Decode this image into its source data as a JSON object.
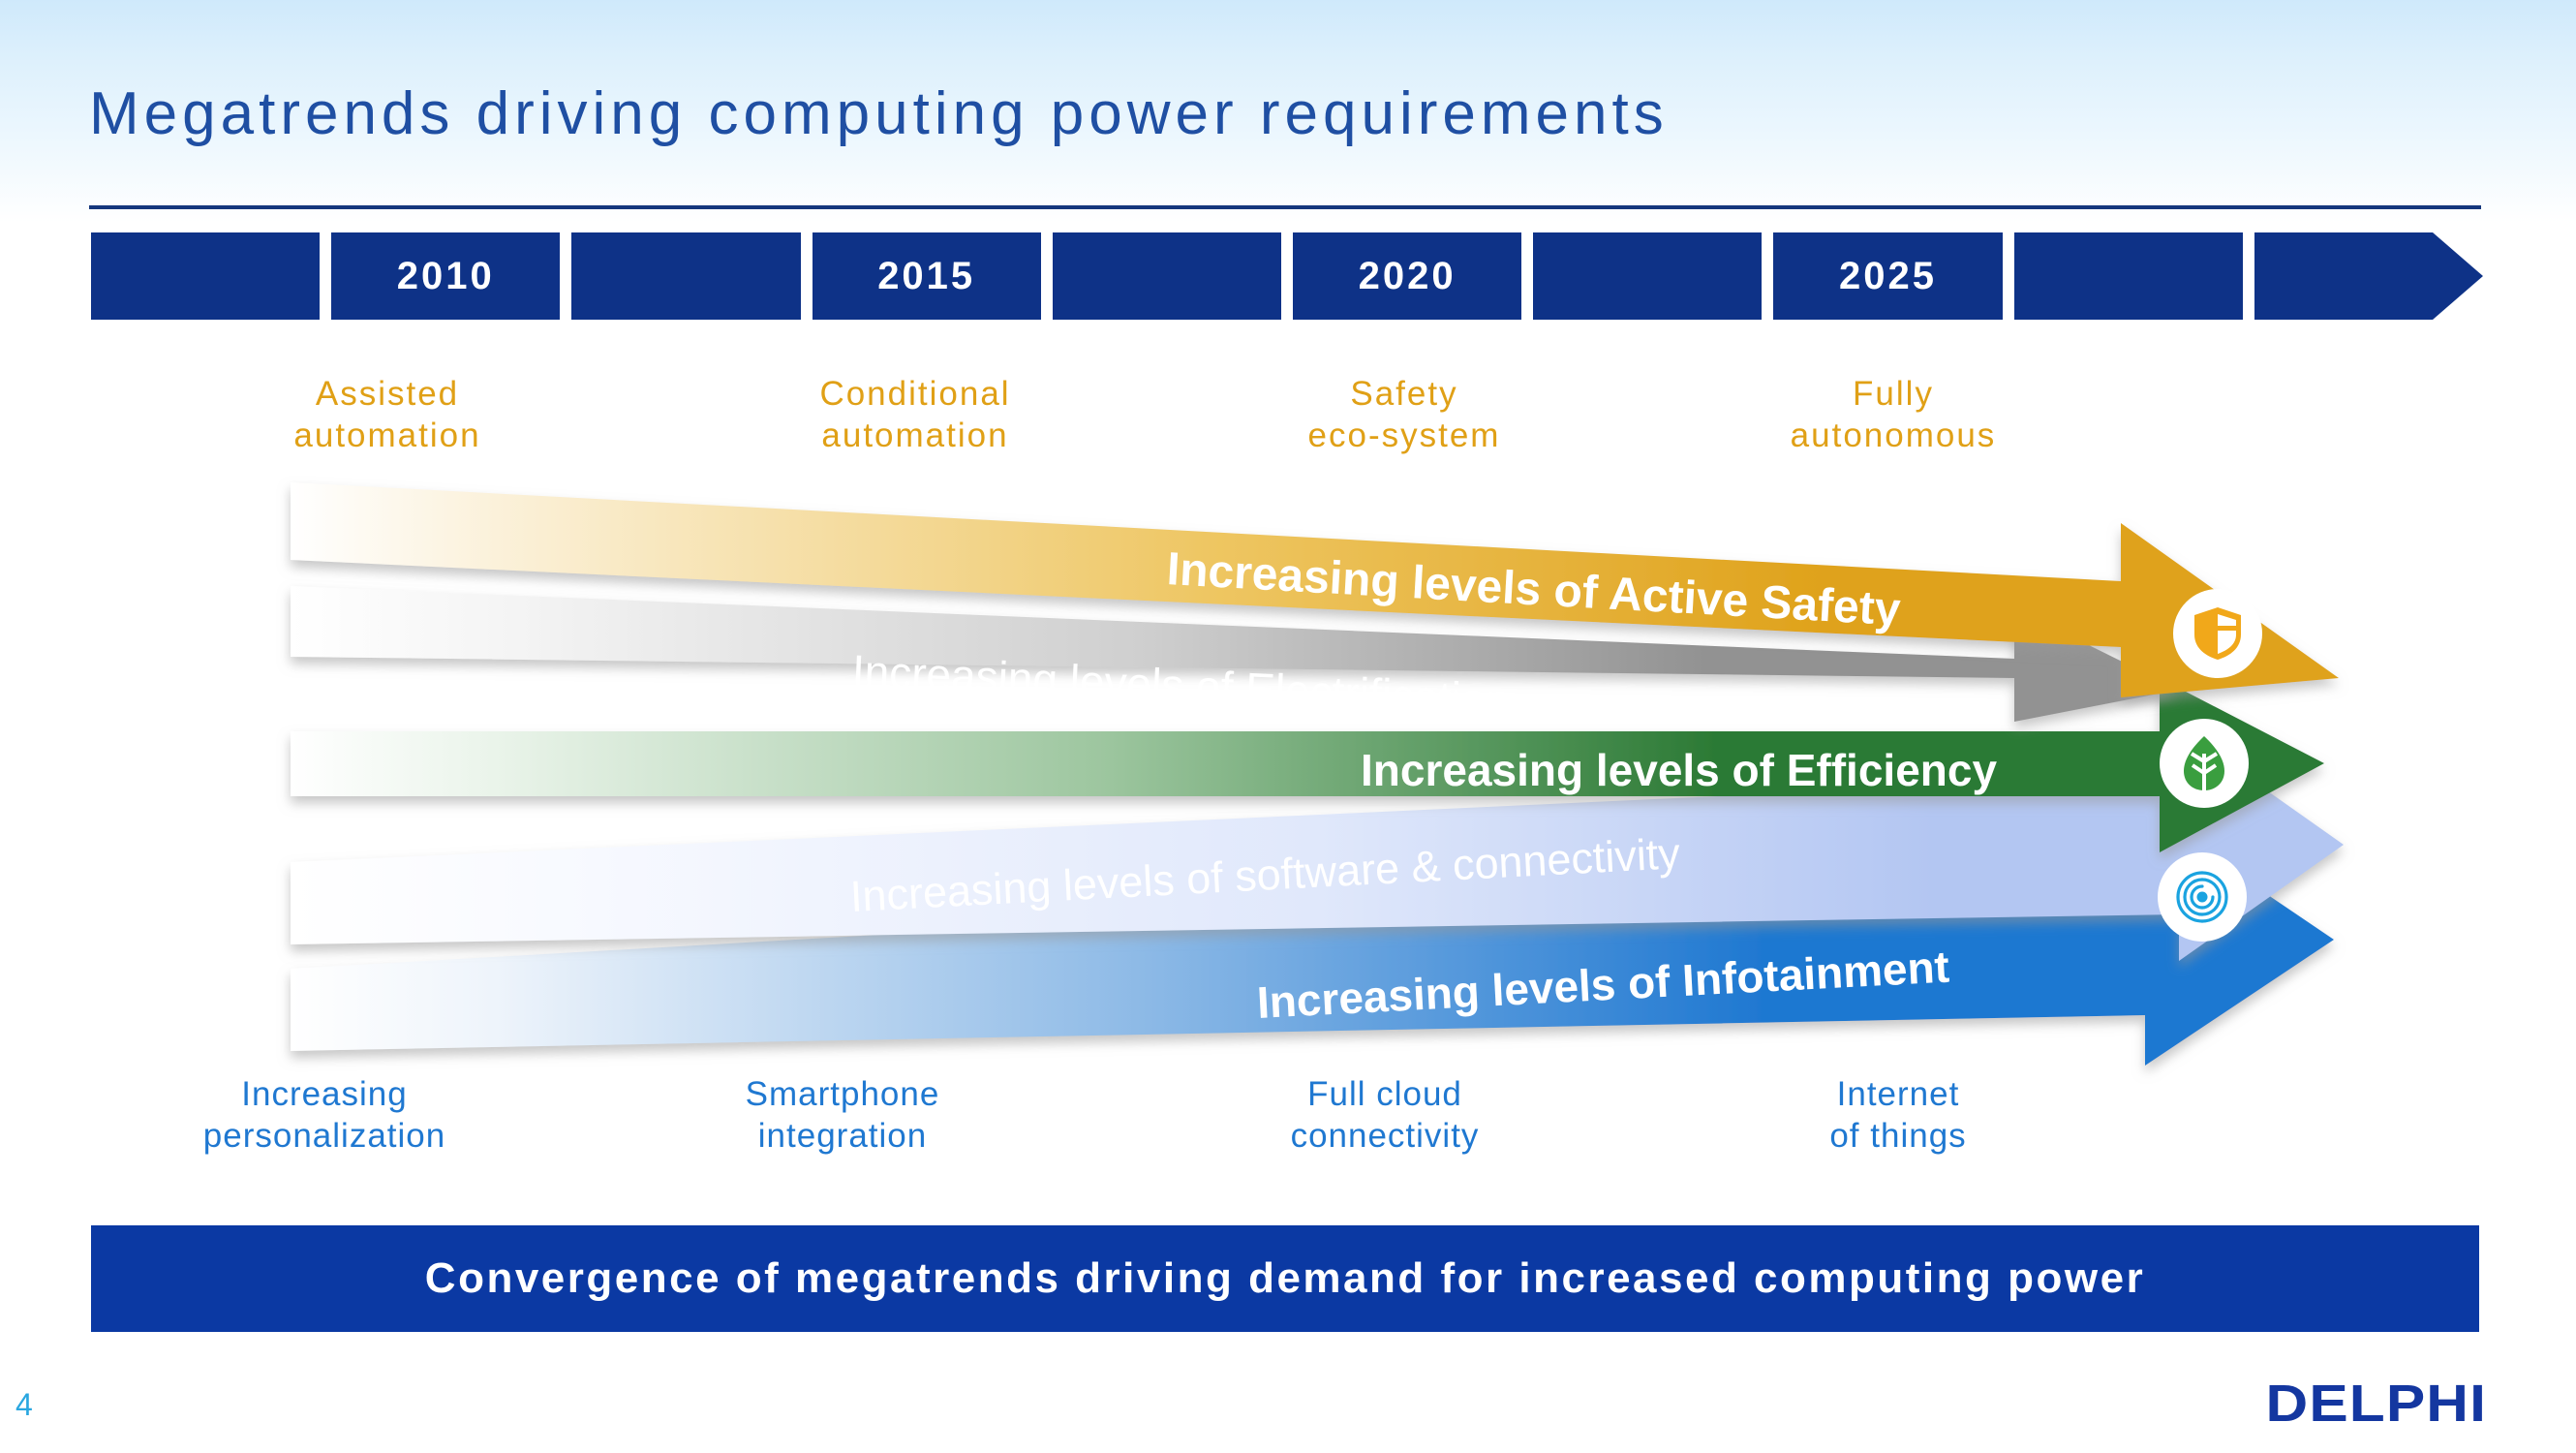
{
  "slide": {
    "title": "Megatrends driving computing power requirements",
    "page_number": "4",
    "logo": "DELPHI",
    "banner": "Convergence of megatrends driving demand for increased computing power"
  },
  "timeline": {
    "segments": [
      {
        "label": ""
      },
      {
        "label": "2010"
      },
      {
        "label": ""
      },
      {
        "label": "2015"
      },
      {
        "label": ""
      },
      {
        "label": "2020"
      },
      {
        "label": ""
      },
      {
        "label": "2025"
      },
      {
        "label": ""
      },
      {
        "label": ""
      }
    ]
  },
  "top_labels": [
    {
      "line1": "Assisted",
      "line2": "automation"
    },
    {
      "line1": "Conditional",
      "line2": "automation"
    },
    {
      "line1": "Safety",
      "line2": "eco-system"
    },
    {
      "line1": "Fully",
      "line2": "autonomous"
    }
  ],
  "bottom_labels": [
    {
      "line1": "Increasing",
      "line2": "personalization"
    },
    {
      "line1": "Smartphone",
      "line2": "integration"
    },
    {
      "line1": "Full cloud",
      "line2": "connectivity"
    },
    {
      "line1": "Internet",
      "line2": "of things"
    }
  ],
  "bands": [
    {
      "label": "Increasing levels of Active Safety",
      "color": "#dfa21b",
      "icon": "shield-icon"
    },
    {
      "label": "Increasing levels of Electrification",
      "color": "#929292",
      "icon": ""
    },
    {
      "label": "Increasing levels of Efficiency",
      "color": "#2c7a35",
      "icon": "leaf-icon"
    },
    {
      "label": "Increasing levels of software & connectivity",
      "color": "#b3c6f2",
      "icon": ""
    },
    {
      "label": "Increasing levels of Infotainment",
      "color": "#1f78d1",
      "icon": "connectivity-icon"
    }
  ],
  "colors": {
    "title": "#1f4fa3",
    "navy": "#0e3287",
    "banner_blue": "#0b39a3",
    "orange_label": "#e0a016",
    "blue_label": "#1f78d1",
    "page_num": "#2aa7e0",
    "logo": "#1437a0"
  }
}
